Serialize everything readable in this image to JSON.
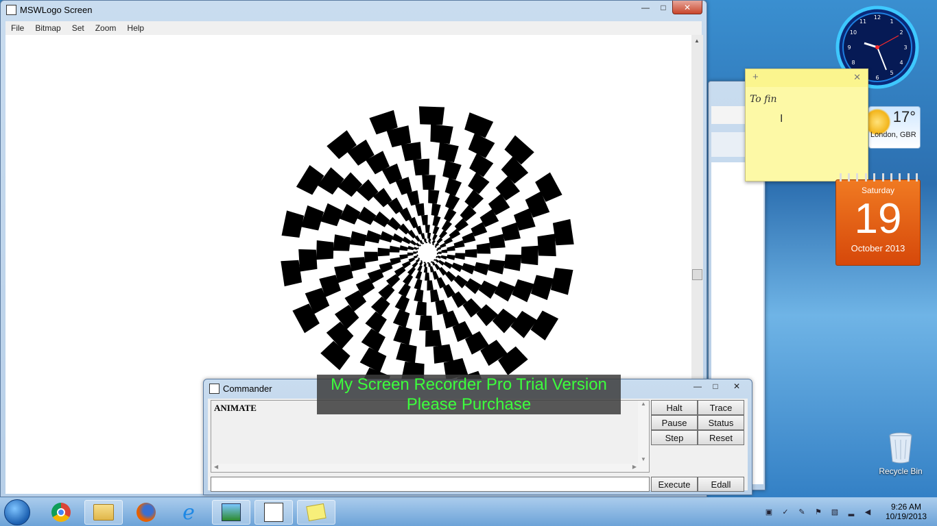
{
  "mswlogo": {
    "title": "MSWLogo Screen",
    "menu": [
      "File",
      "Bitmap",
      "Set",
      "Zoom",
      "Help"
    ]
  },
  "commander": {
    "title": "Commander",
    "output_text": "ANIMATE",
    "input_value": "",
    "buttons": {
      "halt": "Halt",
      "trace": "Trace",
      "pause": "Pause",
      "status": "Status",
      "step": "Step",
      "reset": "Reset",
      "execute": "Execute",
      "edall": "Edall"
    }
  },
  "watermark": {
    "line1": "My Screen Recorder Pro Trial Version",
    "line2": "Please Purchase"
  },
  "sticky_note": {
    "text": "To fin"
  },
  "weather": {
    "temp": "17°",
    "location": "London, GBR"
  },
  "calendar": {
    "weekday": "Saturday",
    "day": "19",
    "month_year": "October 2013"
  },
  "desktop": {
    "recycle_bin": "Recycle Bin"
  },
  "clock": {
    "time": "9:26 AM",
    "date": "10/19/2013"
  },
  "taskbar": {
    "items": [
      "start-icon",
      "chrome-icon",
      "explorer-icon",
      "firefox-icon",
      "ie-icon",
      "app-icon",
      "mswlogo-icon",
      "sticky-notes-icon"
    ]
  }
}
